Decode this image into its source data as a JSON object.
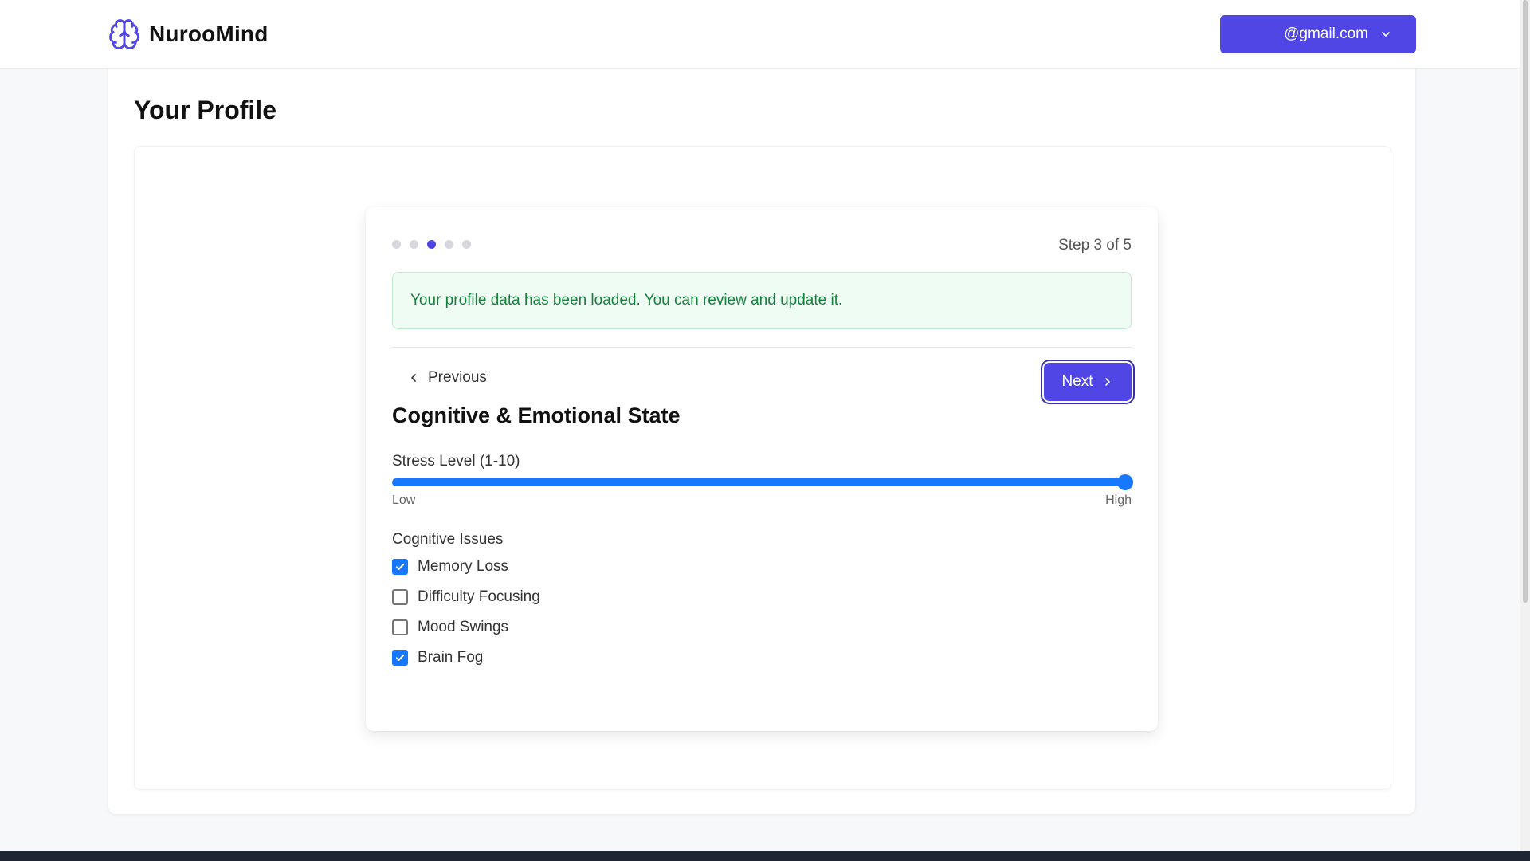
{
  "app": {
    "name": "NurooMind",
    "logo_icon": "brain-icon",
    "accent_color": "#4f46e5"
  },
  "account": {
    "email": "@gmail.com",
    "icon": "chevron-down-icon"
  },
  "page": {
    "title": "Your Profile"
  },
  "wizard": {
    "current_step": 3,
    "total_steps": 5,
    "step_label": "Step 3 of 5",
    "alert_message": "Your profile data has been loaded. You can review and update it.",
    "alert_color": "#17803d",
    "previous_label": "Previous",
    "next_label": "Next",
    "section_title": "Cognitive & Emotional State",
    "stress": {
      "label": "Stress Level (1-10)",
      "value": 10,
      "min": 1,
      "max": 10,
      "low_label": "Low",
      "high_label": "High",
      "color": "#1677ff"
    },
    "cognitive_issues": {
      "label": "Cognitive Issues",
      "options": [
        {
          "label": "Memory Loss",
          "checked": true
        },
        {
          "label": "Difficulty Focusing",
          "checked": false
        },
        {
          "label": "Mood Swings",
          "checked": false
        },
        {
          "label": "Brain Fog",
          "checked": true
        }
      ]
    }
  }
}
